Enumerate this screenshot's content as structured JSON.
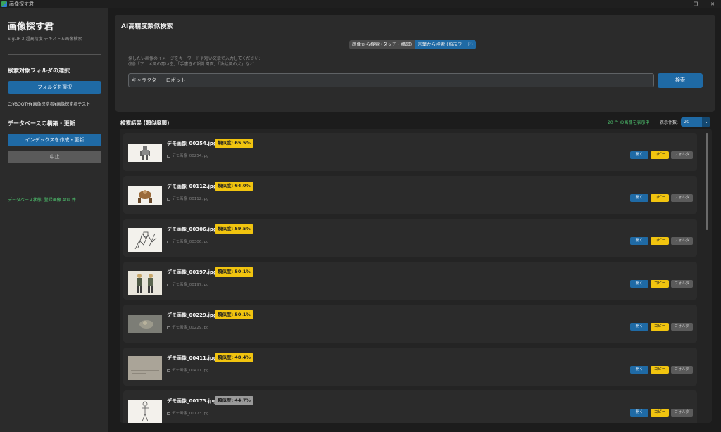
{
  "window": {
    "title": "画像探す君"
  },
  "sidebar": {
    "app_title": "画像探す君",
    "app_subtitle": "SigLIP 2 超高精度 テキスト＆画像検索",
    "folder_section_title": "検索対象フォルダの選択",
    "folder_button_label": "フォルダを選択",
    "folder_path": "C:¥BOOTH¥画像探す君¥画像探す君テスト",
    "db_section_title": "データベースの構築・更新",
    "index_button_label": "インデックスを作成・更新",
    "stop_button_label": "中止",
    "db_status": "データベース状態: 登録画像 409 件"
  },
  "main": {
    "title": "AI高精度類似検索",
    "mode_tabs": [
      {
        "label": "画像から検索 (タッチ・構図)",
        "active": false
      },
      {
        "label": "言葉から検索 (指示ワード)",
        "active": true
      }
    ],
    "hint_line1": "探したい画像のイメージをキーワードや短い文章で入力してください:",
    "hint_line2": "(例)「アニメ風の青い空」「手書きの設計図面」「油絵風の犬」など",
    "search_value": "キャラクター　ロボット",
    "search_button_label": "検索"
  },
  "results": {
    "header": "検索結果 (類似度順)",
    "count_text": "20 件 の画像を表示中",
    "per_page_label": "表示件数:",
    "per_page_value": "20",
    "button_labels": {
      "open": "開く",
      "copy": "コピー",
      "folder": "フォルダ"
    },
    "items": [
      {
        "filename": "デモ画像_00254.jpg",
        "similarity": "類似度: 65.5%",
        "path": "デモ画像_00254.jpg",
        "badge_color": "#f1c40f"
      },
      {
        "filename": "デモ画像_00112.jpg",
        "similarity": "類似度: 64.0%",
        "path": "デモ画像_00112.jpg",
        "badge_color": "#f1c40f"
      },
      {
        "filename": "デモ画像_00306.jpg",
        "similarity": "類似度: 59.5%",
        "path": "デモ画像_00306.jpg",
        "badge_color": "#f1c40f"
      },
      {
        "filename": "デモ画像_00197.jpg",
        "similarity": "類似度: 50.1%",
        "path": "デモ画像_00197.jpg",
        "badge_color": "#f1c40f"
      },
      {
        "filename": "デモ画像_00229.jpg",
        "similarity": "類似度: 50.1%",
        "path": "デモ画像_00229.jpg",
        "badge_color": "#f1c40f"
      },
      {
        "filename": "デモ画像_00411.jpg",
        "similarity": "類似度: 48.4%",
        "path": "デモ画像_00411.jpg",
        "badge_color": "#f1c40f"
      },
      {
        "filename": "デモ画像_00173.jpg",
        "similarity": "類似度: 44.7%",
        "path": "デモ画像_00173.jpg",
        "badge_color": "#9a9a9a"
      }
    ]
  }
}
